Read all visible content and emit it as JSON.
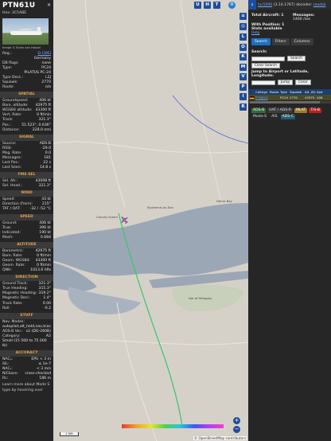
{
  "aircraft": {
    "callsign": "PTN61U",
    "hex_line": "Hex: 3C5ABE",
    "photo_credit": "Image © Erwin van Hassel",
    "details": [
      {
        "k": "Reg.:",
        "v": "D-CMEI",
        "link": true
      },
      {
        "k": "",
        "v": "Germany"
      },
      {
        "k": "DB flags:",
        "v": "none"
      },
      {
        "k": "Type:",
        "v": "PC24"
      },
      {
        "k": "",
        "v": "PILATUS PC-24"
      },
      {
        "k": "Type Desc.:",
        "v": "L2J"
      },
      {
        "k": "Squawk:",
        "v": "2770"
      },
      {
        "k": "Route:",
        "v": "n/a"
      }
    ]
  },
  "sections": [
    {
      "title": "SPATIAL",
      "rows": [
        {
          "k": "Groundspeed:",
          "v": "406 kt"
        },
        {
          "k": "Baro. altitude:",
          "v": "42975 ft"
        },
        {
          "k": "WGS84 altitude:",
          "v": "43300 ft"
        },
        {
          "k": "Vert. Rate:",
          "v": "0 ft/min"
        },
        {
          "k": "Track:",
          "v": "321.3°"
        },
        {
          "k": "Pos.:",
          "v": "51.523°, 0.636°"
        },
        {
          "k": "Distance:",
          "v": "228.0 nmi"
        }
      ]
    },
    {
      "title": "SIGNAL",
      "rows": [
        {
          "k": "Source:",
          "v": "ADS-B"
        },
        {
          "k": "RSSI:",
          "v": "-29.0"
        },
        {
          "k": "Msg. Rate:",
          "v": "0.0"
        },
        {
          "k": "Messages:",
          "v": "181"
        },
        {
          "k": "Last Pos.:",
          "v": "22 s"
        },
        {
          "k": "Last Seen:",
          "v": "14.8 s"
        }
      ]
    },
    {
      "title": "FMS SEL",
      "rows": [
        {
          "k": "Sel. Alt.:",
          "v": "43008 ft"
        },
        {
          "k": "Sel. Head.:",
          "v": "321.3°"
        }
      ]
    },
    {
      "title": "WIND",
      "rows": [
        {
          "k": "Speed:",
          "v": "43 kt"
        },
        {
          "k": "Direction (from):",
          "v": "215°"
        },
        {
          "k": "TAT / OAT:",
          "v": "-32 / -52 °C"
        }
      ]
    },
    {
      "title": "SPEED",
      "rows": [
        {
          "k": "Ground:",
          "v": "406 kt"
        },
        {
          "k": "True:",
          "v": "396 kt"
        },
        {
          "k": "Indicated:",
          "v": "190 kt"
        },
        {
          "k": "Mach:",
          "v": "0.684"
        }
      ]
    },
    {
      "title": "ALTITUDE",
      "rows": [
        {
          "k": "Barometric:",
          "v": "42975 ft"
        },
        {
          "k": "Baro. Rate:",
          "v": "0 ft/min"
        },
        {
          "k": "Geom. WGS84:",
          "v": "43300 ft"
        },
        {
          "k": "Geom. Rate:",
          "v": "0 ft/min"
        },
        {
          "k": "QNH:",
          "v": "1013.6 hPa"
        }
      ]
    },
    {
      "title": "DIRECTION",
      "rows": [
        {
          "k": "Ground Track:",
          "v": "321.3°"
        },
        {
          "k": "True Heading:",
          "v": "315.3°"
        },
        {
          "k": "Magnetic Heading:",
          "v": "319.2°"
        },
        {
          "k": "Magnetic Decl.:",
          "v": "1.4°"
        },
        {
          "k": "Track Rate:",
          "v": "0.00"
        },
        {
          "k": "Roll:",
          "v": "-0.2"
        }
      ]
    }
  ],
  "stuff": {
    "title": "STUFF",
    "nav_modes_label": "Nav. Modes:",
    "nav_modes_value": "autopilot,alt_hold,nav,tcas",
    "adsb_ver_k": "ADS-B Ver.:",
    "adsb_ver_v": "v2 (DO-260B)",
    "category_k": "Category:",
    "category_v": "A2",
    "category_desc": "Small (15 500 to 75 000 lb)"
  },
  "accuracy": {
    "title": "ACCURACY",
    "rows": [
      {
        "k": "NACₚ:",
        "v": "EPU < 3 m"
      },
      {
        "k": "SIL:",
        "v": "≤ 1e-7"
      },
      {
        "k": "NACᵥ:",
        "v": "< 3 m/s"
      },
      {
        "k": "NICbaro:",
        "v": "cross-checked"
      },
      {
        "k": "Rc:",
        "v": "186 m"
      }
    ]
  },
  "footer_text": "Learn more about Mode S type by hovering over",
  "map": {
    "buttons_top": [
      "U",
      "H",
      "T"
    ],
    "buttons_side": [
      "L",
      "O",
      "K",
      "M",
      "V",
      "P",
      "I",
      "R"
    ],
    "scale_label": "2 NM",
    "attribution": "© OpenStreetMap contributors",
    "zoom_in": "+",
    "zoom_out": "−",
    "places": [
      "Southend-on-Sea",
      "Canvey Island",
      "Isle of Sheppey",
      "Herne Bay"
    ]
  },
  "panel": {
    "version_link": "tar1090",
    "version_text": "(3.14.1767)",
    "decoder_text": "decoder:",
    "decoder_link": "readsb",
    "total_aircraft": "Total Aircraft: 1",
    "messages_label": "Messages:",
    "messages_value": "1460 /sec",
    "with_position": "With Position: 1",
    "stats_available": "Stats available",
    "help": "Help",
    "tabs": [
      "Search",
      "Filters",
      "Columns"
    ],
    "search_label": "Search:",
    "search_button": "Search",
    "clear_search": "Clear Search",
    "jump_label": "Jump to Airport or Latitude, Longitude:",
    "jump_button": "Jump",
    "clear_button": "Clear",
    "table_headers": [
      "",
      "Callsign",
      "Route",
      "Type",
      "Squawk",
      "Alt. (ft)",
      "Spd"
    ],
    "table_row": [
      "",
      "PTN61U",
      "",
      "PC24",
      "2770",
      "42975",
      "406"
    ],
    "sources": [
      "ADS-B",
      "UAT / ADS-R",
      "MLAT",
      "TIS-B",
      "Mode-S",
      "AIS",
      "ADS-C"
    ]
  },
  "colors": {
    "accent_blue": "#1d4e9e",
    "section_orange": "#e4a04a",
    "track_line": "#36c66e",
    "aircraft_marker": "#c85bd0"
  }
}
